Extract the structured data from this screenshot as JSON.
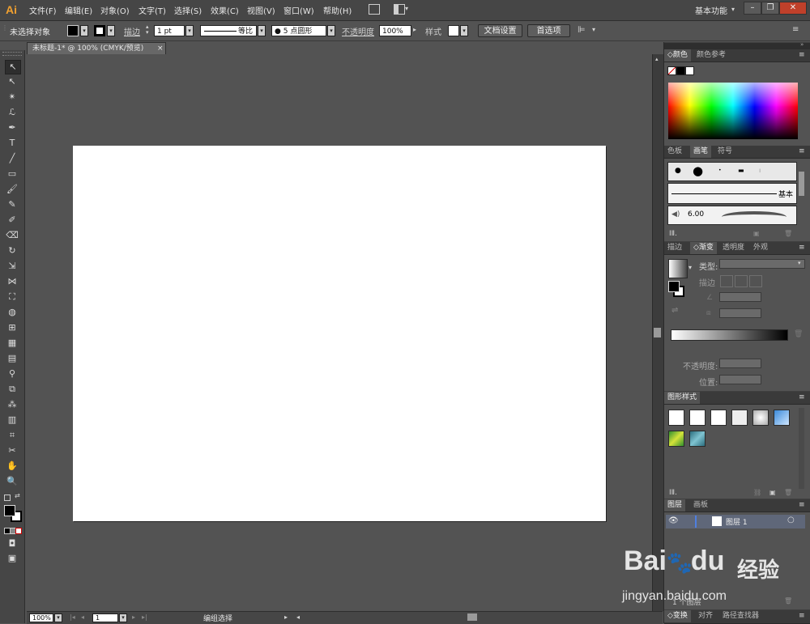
{
  "app": {
    "logo": "Ai",
    "workspace": "基本功能"
  },
  "menu": [
    "文件(F)",
    "编辑(E)",
    "对象(O)",
    "文字(T)",
    "选择(S)",
    "效果(C)",
    "视图(V)",
    "窗口(W)",
    "帮助(H)"
  ],
  "window_controls": {
    "minimize": "–",
    "restore": "❐",
    "close": "✕"
  },
  "control": {
    "no_selection": "未选择对象",
    "stroke_label": "描边",
    "stroke_value": "1 pt",
    "stroke_profile": "等比",
    "brush": "5 点圆形",
    "opacity_label": "不透明度",
    "opacity_value": "100%",
    "style_label": "样式",
    "doc_setup": "文档设置",
    "preferences": "首选项"
  },
  "document": {
    "tab": "未标题-1* @ 100% (CMYK/预览)",
    "close": "×"
  },
  "status": {
    "zoom": "100%",
    "artboard": "1",
    "tool": "编组选择"
  },
  "panels": {
    "color": {
      "tabs": [
        "颜色",
        "颜色参考"
      ]
    },
    "brushes": {
      "tabs": [
        "色板",
        "画笔",
        "符号"
      ],
      "basic": "基本",
      "size": "6.00"
    },
    "stroke_grad": {
      "tabs": [
        "描边",
        "渐变",
        "透明度",
        "外观"
      ],
      "type": "类型:",
      "stroke": "描边",
      "opacity": "不透明度:",
      "position": "位置:"
    },
    "graphic_styles": {
      "tabs": [
        "图形样式"
      ]
    },
    "layers": {
      "tabs": [
        "图层",
        "画板"
      ],
      "layer_name": "图层 1",
      "count": "1 个图层"
    },
    "bottom": {
      "tabs": [
        "变换",
        "对齐",
        "路径查找器"
      ]
    }
  },
  "watermark": {
    "brand": "Bai",
    "brand2": "du",
    "brand_cn": "经验",
    "url": "jingyan.baidu.com"
  },
  "colors": {
    "accent": "#f0a030",
    "panel": "#535353",
    "dark": "#464646"
  }
}
